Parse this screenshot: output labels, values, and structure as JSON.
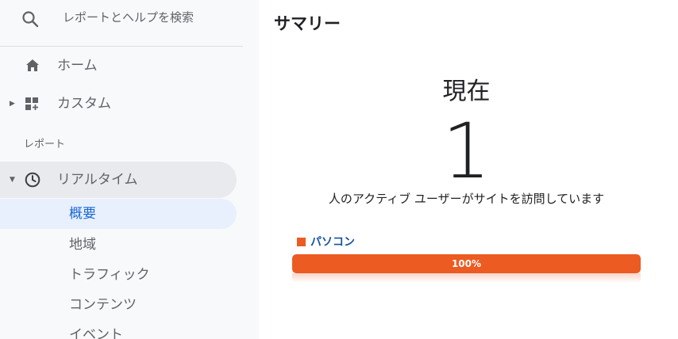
{
  "search": {
    "placeholder": "レポートとヘルプを検索",
    "icon": "search-icon"
  },
  "nav": {
    "home": {
      "label": "ホーム",
      "icon": "home-icon"
    },
    "custom": {
      "label": "カスタム",
      "icon": "dashboard-icon"
    },
    "section_label": "レポート",
    "realtime": {
      "label": "リアルタイム",
      "icon": "clock-icon",
      "children": [
        "概要",
        "地域",
        "トラフィック",
        "コンテンツ",
        "イベント"
      ]
    }
  },
  "main": {
    "title": "サマリー",
    "now_label": "現在",
    "now_value": "1",
    "now_desc": "人のアクティブ ユーザーがサイトを訪問しています",
    "device": {
      "label": "パソコン",
      "percent_text": "100%",
      "fraction": 1.0
    }
  },
  "colors": {
    "accent": "#ec5b22",
    "link": "#1a53a0",
    "active_sub_bg": "#e8f0fe",
    "active_sub_text": "#1967d2"
  }
}
